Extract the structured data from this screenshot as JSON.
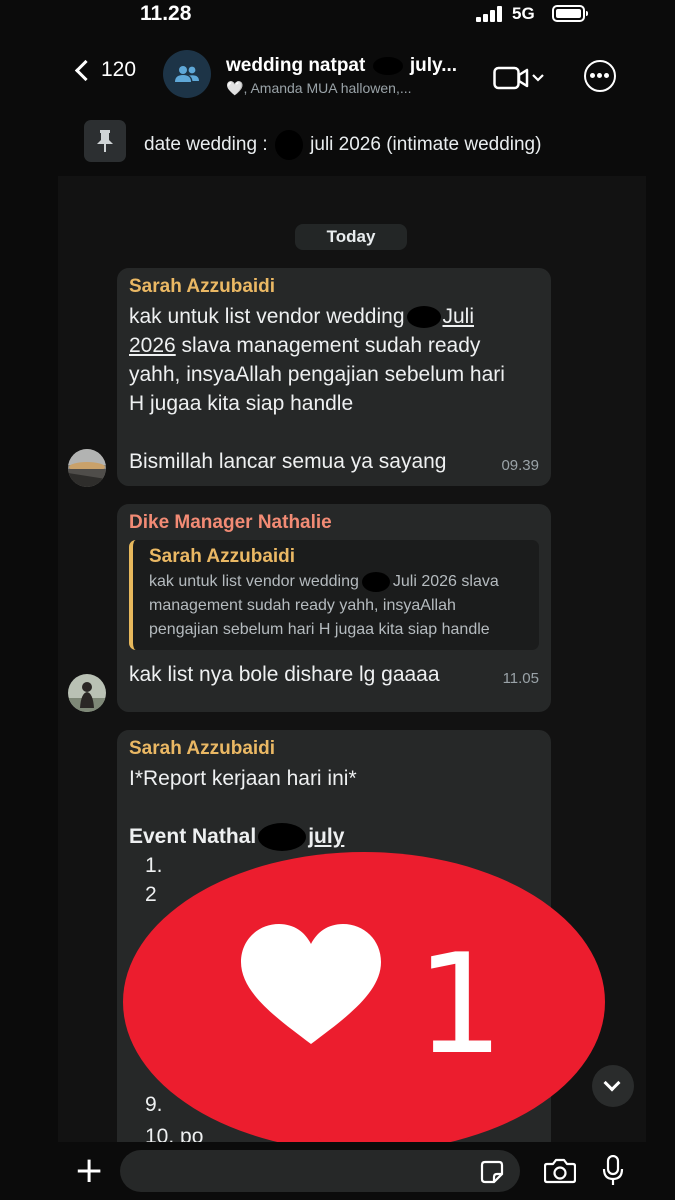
{
  "status_bar": {
    "time": "11.28",
    "network": "5G"
  },
  "header": {
    "back_count": "120",
    "title_start": "wedding natpat",
    "title_end": "july...",
    "subtitle_heart": "🤍",
    "subtitle": ", Amanda MUA hallowen,..."
  },
  "pinned": {
    "text_start": "date wedding :",
    "text_end": "juli 2026 (intimate wedding)"
  },
  "date_label": "Today",
  "messages": [
    {
      "sender": "Sarah Azzubaidi",
      "line1_start": "kak untuk list vendor wedding",
      "line1_end": "Juli",
      "line2_link": "2026",
      "line2_rest": " slava management sudah ready",
      "line3": "yahh, insyaAllah pengajian sebelum hari",
      "line4": "H jugaa kita siap handle",
      "last_line": "Bismillah lancar semua ya sayang",
      "time": "09.39"
    },
    {
      "sender": "Dike Manager Nathalie",
      "quote_sender": "Sarah Azzubaidi",
      "quote_line1_start": "kak untuk list vendor wedding",
      "quote_line1_end": "Juli 2026 slava",
      "quote_line2": "management sudah ready yahh, insyaAllah",
      "quote_line3": "pengajian sebelum hari H jugaa kita siap handle",
      "text": "kak list nya bole dishare lg gaaaa",
      "time": "11.05"
    },
    {
      "sender": "Sarah Azzubaidi",
      "line1": "I*Report kerjaan hari ini*",
      "event_start": "Event Nathal",
      "event_end": "july",
      "item1": "1.",
      "item2": "2",
      "item9": "9.",
      "item10": "10. po"
    }
  ],
  "like_notification": {
    "count": "1"
  },
  "input": {
    "placeholder": ""
  },
  "colors": {
    "sarah_name": "#eab864",
    "dike_name": "#f28b75",
    "heart_red": "#ec1d2e",
    "bubble": "#262828"
  }
}
